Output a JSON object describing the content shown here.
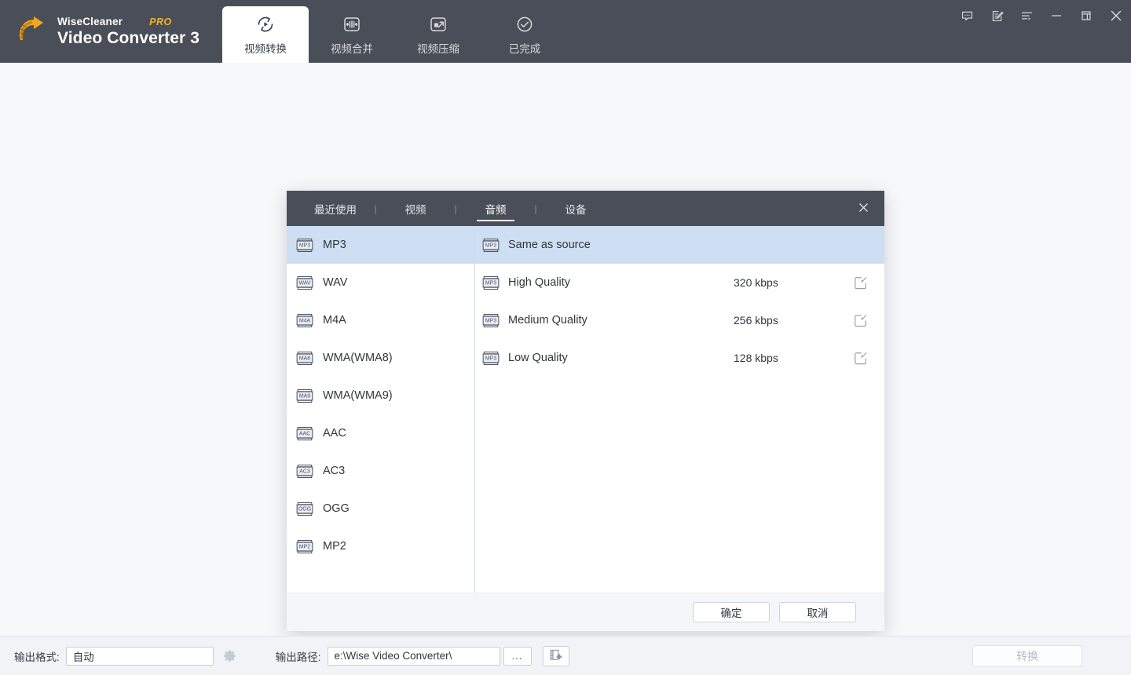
{
  "app": {
    "brand_name": "WiseCleaner",
    "brand_badge": "PRO",
    "product": "Video Converter 3",
    "logo_icon": "wisecleaner-arrow-logo"
  },
  "nav": {
    "tabs": [
      {
        "label": "视频转换",
        "icon": "convert-icon",
        "active": true
      },
      {
        "label": "视频合并",
        "icon": "merge-icon",
        "active": false
      },
      {
        "label": "视频压缩",
        "icon": "compress-icon",
        "active": false
      },
      {
        "label": "已完成",
        "icon": "completed-check-icon",
        "active": false
      }
    ]
  },
  "window_controls": [
    {
      "name": "feedback-icon"
    },
    {
      "name": "register-edit-icon"
    },
    {
      "name": "menu-list-icon"
    },
    {
      "name": "minimize-icon"
    },
    {
      "name": "maximize-icon"
    },
    {
      "name": "close-icon"
    }
  ],
  "dialog": {
    "tabs": [
      {
        "label": "最近使用",
        "active": false
      },
      {
        "label": "视频",
        "active": false
      },
      {
        "label": "音频",
        "active": true
      },
      {
        "label": "设备",
        "active": false
      }
    ],
    "separator": "|",
    "close_icon": "close-icon",
    "formats": [
      {
        "badge": "MP3",
        "label": "MP3",
        "selected": true
      },
      {
        "badge": "WAV",
        "label": "WAV",
        "selected": false
      },
      {
        "badge": "M4A",
        "label": "M4A",
        "selected": false
      },
      {
        "badge": "MA8",
        "label": "WMA(WMA8)",
        "selected": false
      },
      {
        "badge": "MA9",
        "label": "WMA(WMA9)",
        "selected": false
      },
      {
        "badge": "AAC",
        "label": "AAC",
        "selected": false
      },
      {
        "badge": "AC3",
        "label": "AC3",
        "selected": false
      },
      {
        "badge": "OGG",
        "label": "OGG",
        "selected": false
      },
      {
        "badge": "MP2",
        "label": "MP2",
        "selected": false
      }
    ],
    "qualities": [
      {
        "badge": "MP3",
        "label": "Same as source",
        "bitrate": "",
        "selected": true,
        "editable": false
      },
      {
        "badge": "MP3",
        "label": "High Quality",
        "bitrate": "320 kbps",
        "selected": false,
        "editable": true
      },
      {
        "badge": "MP3",
        "label": "Medium Quality",
        "bitrate": "256 kbps",
        "selected": false,
        "editable": true
      },
      {
        "badge": "MP3",
        "label": "Low Quality",
        "bitrate": "128 kbps",
        "selected": false,
        "editable": true
      }
    ],
    "ok_label": "确定",
    "cancel_label": "取消",
    "edit_icon": "edit-pencil-icon"
  },
  "bottom_bar": {
    "output_format_label": "输出格式:",
    "output_format_value": "自动",
    "settings_icon": "gear-icon",
    "output_path_label": "输出路径:",
    "output_path_value": "e:\\Wise Video Converter\\",
    "browse_label": "...",
    "add_file_icon": "add-media-file-icon",
    "convert_label": "转换"
  },
  "colors": {
    "header_bg": "#4a4e58",
    "body_bg": "#f7f8fa",
    "selection": "#cfdff3",
    "accent_pro": "#f2b22a",
    "bottom_bar_bg": "#f1f3f7"
  }
}
